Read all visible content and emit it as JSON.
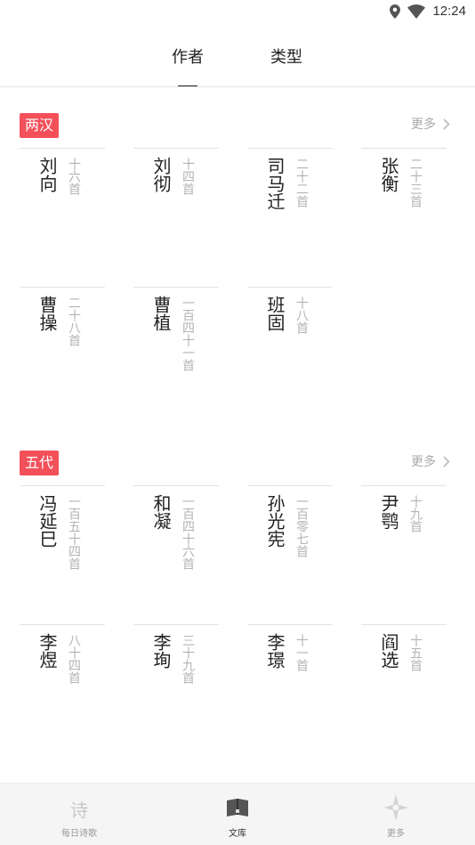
{
  "status": {
    "time": "12:24"
  },
  "tabs": [
    {
      "label": "作者",
      "active": true
    },
    {
      "label": "类型",
      "active": false
    }
  ],
  "sections": [
    {
      "tag": "两汉",
      "more": "更多",
      "authors": [
        {
          "name": "刘向",
          "count": "十六首"
        },
        {
          "name": "刘彻",
          "count": "十四首"
        },
        {
          "name": "司马迁",
          "count": "二十二首"
        },
        {
          "name": "张衡",
          "count": "二十三首"
        },
        {
          "name": "曹操",
          "count": "二十八首"
        },
        {
          "name": "曹植",
          "count": "一百四十一首"
        },
        {
          "name": "班固",
          "count": "十八首"
        }
      ]
    },
    {
      "tag": "五代",
      "more": "更多",
      "authors": [
        {
          "name": "冯延巳",
          "count": "一百五十四首"
        },
        {
          "name": "和凝",
          "count": "一百四十六首"
        },
        {
          "name": "孙光宪",
          "count": "一百零七首"
        },
        {
          "name": "尹鹗",
          "count": "十九首"
        },
        {
          "name": "李煜",
          "count": "八十四首"
        },
        {
          "name": "李珣",
          "count": "三十九首"
        },
        {
          "name": "李璟",
          "count": "十一首"
        },
        {
          "name": "阎选",
          "count": "十五首"
        }
      ]
    }
  ],
  "bottom_nav": [
    {
      "label": "每日诗歌",
      "icon": "poem-character-icon",
      "glyph": "诗",
      "active": false
    },
    {
      "label": "文库",
      "icon": "open-book-icon",
      "active": true
    },
    {
      "label": "更多",
      "icon": "compass-star-icon",
      "active": false
    }
  ],
  "colors": {
    "accent": "#f4505a",
    "muted_text": "#b4b4b4",
    "nav_bg": "#f5f5f5"
  }
}
